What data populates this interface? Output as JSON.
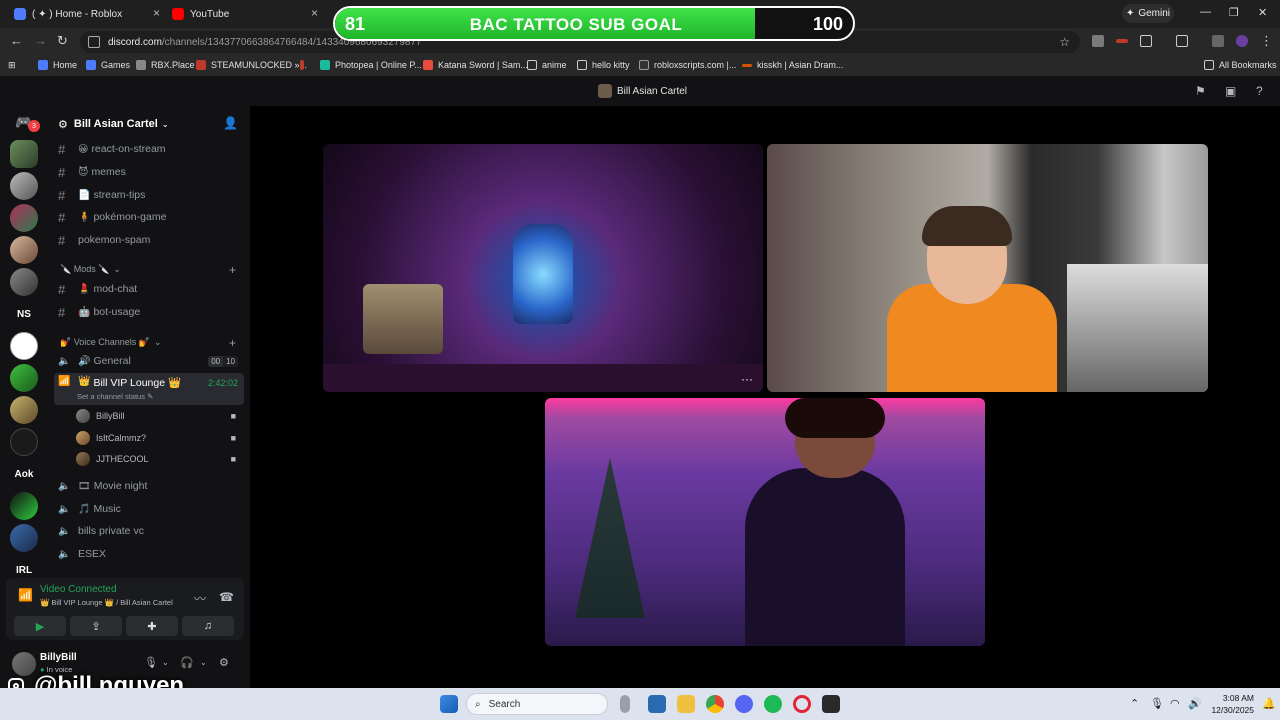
{
  "browser": {
    "tabs": [
      {
        "title": "( ✦ ) Home - Roblox"
      },
      {
        "title": "YouTube"
      }
    ],
    "gemini_label": "Gemini",
    "url_host": "discord.com",
    "url_path": "/channels/1343770663864766484/1433409680693279877",
    "bookmarks": [
      "Home",
      "Games",
      "RBX.Place",
      "STEAMUNLOCKED »...",
      "Photopea | Online P...",
      "Katana Sword | Sam...",
      "anime",
      "hello kitty",
      "robloxscripts.com |...",
      "kisskh | Asian Dram..."
    ],
    "all_bookmarks": "All Bookmarks"
  },
  "sub_goal": {
    "current": "81",
    "goal": "100",
    "title": "BAC TATTOO SUB GOAL",
    "progress": 0.81
  },
  "discord": {
    "top_title": "Bill Asian Cartel",
    "server_name": "Bill Asian Cartel",
    "mention_badge": "3",
    "guild_text": [
      "NS",
      "Aok",
      "IRL"
    ],
    "channels": [
      {
        "emoji": "😀",
        "name": "react-on-stream"
      },
      {
        "emoji": "😈",
        "name": "memes"
      },
      {
        "emoji": "📄",
        "name": "stream-tips"
      },
      {
        "emoji": "🧍",
        "name": "pokémon-game"
      },
      {
        "emoji": "",
        "name": "pokemon-spam"
      }
    ],
    "mods_category": "🔪 Mods 🔪",
    "mod_channels": [
      {
        "emoji": "💄",
        "name": "mod-chat"
      },
      {
        "emoji": "🤖",
        "name": "bot-usage"
      }
    ],
    "voice_category": "💅 Voice Channels 💅",
    "voice_channels": [
      {
        "emoji": "🔊",
        "name": "General",
        "count_a": "00",
        "count_b": "10"
      },
      {
        "emoji": "👑",
        "name": "Bill VIP Lounge 👑",
        "time": "2:42:02",
        "status": "Set a channel status"
      }
    ],
    "members": [
      {
        "name": "BillyBill"
      },
      {
        "name": "IsItCalmmz?"
      },
      {
        "name": "JJTHECOOL"
      }
    ],
    "more_voice": [
      {
        "emoji": "🎞",
        "name": "Movie night"
      },
      {
        "emoji": "🎵",
        "name": "Music"
      },
      {
        "emoji": "",
        "name": "bills private vc"
      },
      {
        "emoji": "",
        "name": "ESEX"
      }
    ],
    "voice_panel": {
      "status": "Video Connected",
      "where": "👑 Bill VIP Lounge 👑 / Bill Asian Cartel"
    },
    "user": {
      "name": "BillyBill",
      "state": "In voice"
    }
  },
  "watermark": "@bill.nguyen",
  "taskbar": {
    "search": "Search",
    "time": "3:08 AM",
    "date": "12/30/2025"
  },
  "colors": {
    "discord_green": "#23a55a",
    "goal_green": "#2fd13a"
  }
}
